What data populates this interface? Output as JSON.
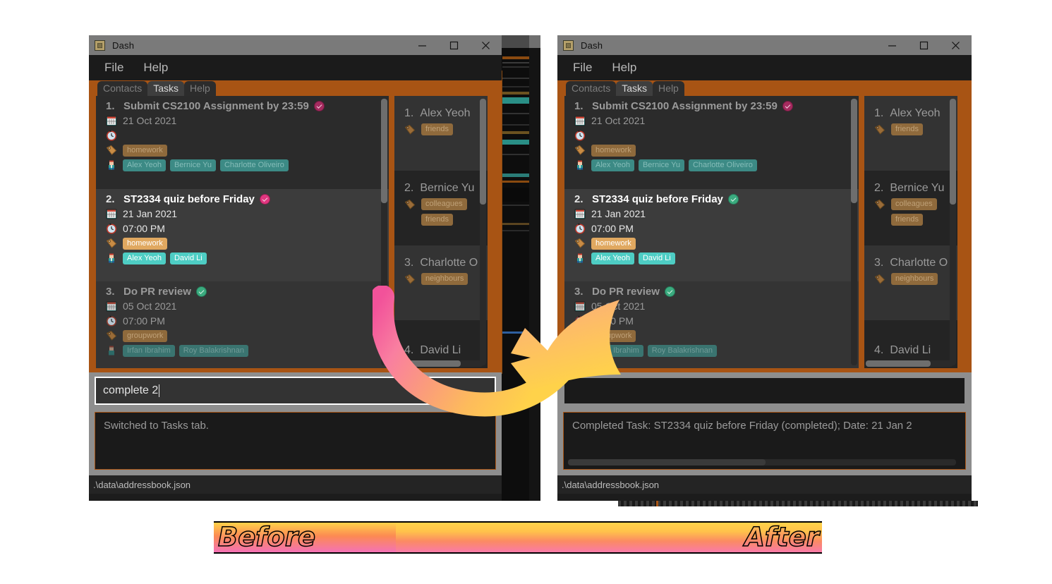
{
  "window": {
    "title": "Dash",
    "icon": "app-icon",
    "controls": {
      "minimize": "minimize-icon",
      "maximize": "maximize-icon",
      "close": "close-icon"
    },
    "menu": [
      "File",
      "Help"
    ],
    "tabs": [
      {
        "label": "Contacts",
        "active": false
      },
      {
        "label": "Tasks",
        "active": true
      },
      {
        "label": "Help",
        "active": false
      }
    ],
    "status_path": ".\\data\\addressbook.json"
  },
  "before": {
    "command_input": {
      "value": "complete 2",
      "placeholder": ""
    },
    "result": "Switched to Tasks tab.",
    "tasks": [
      {
        "index": "1.",
        "name": "Submit CS2100 Assignment by 23:59",
        "status": "incomplete",
        "date": "21 Oct 2021",
        "time": "",
        "tags": [
          "homework"
        ],
        "people": [
          "Alex Yeoh",
          "Bernice Yu",
          "Charlotte Oliveiro"
        ],
        "selected": false
      },
      {
        "index": "2.",
        "name": "ST2334 quiz before Friday",
        "status": "incomplete",
        "date": "21 Jan 2021",
        "time": "07:00 PM",
        "tags": [
          "homework"
        ],
        "people": [
          "Alex Yeoh",
          "David Li"
        ],
        "selected": true
      },
      {
        "index": "3.",
        "name": "Do PR review",
        "status": "complete",
        "date": "05 Oct 2021",
        "time": "07:00 PM",
        "tags": [
          "groupwork"
        ],
        "people": [
          "Irfan Ibrahim",
          "Roy Balakrishnan"
        ],
        "selected": false
      }
    ],
    "contacts": [
      {
        "index": "1.",
        "name": "Alex Yeoh",
        "tags": [
          "friends"
        ]
      },
      {
        "index": "2.",
        "name": "Bernice Yu",
        "tags": [
          "colleagues",
          "friends"
        ]
      },
      {
        "index": "3.",
        "name": "Charlotte O",
        "tags": [
          "neighbours"
        ]
      },
      {
        "index": "4.",
        "name": "David Li",
        "tags": []
      }
    ]
  },
  "after": {
    "command_input": {
      "value": "",
      "placeholder": ""
    },
    "result": "Completed Task: ST2334 quiz before Friday (completed); Date: 21 Jan 2",
    "tasks": [
      {
        "index": "1.",
        "name": "Submit CS2100 Assignment by 23:59",
        "status": "incomplete",
        "date": "21 Oct 2021",
        "time": "",
        "tags": [
          "homework"
        ],
        "people": [
          "Alex Yeoh",
          "Bernice Yu",
          "Charlotte Oliveiro"
        ],
        "selected": false
      },
      {
        "index": "2.",
        "name": "ST2334 quiz before Friday",
        "status": "complete",
        "date": "21 Jan 2021",
        "time": "07:00 PM",
        "tags": [
          "homework"
        ],
        "people": [
          "Alex Yeoh",
          "David Li"
        ],
        "selected": true
      },
      {
        "index": "3.",
        "name": "Do PR review",
        "status": "complete",
        "date": "05 Oct 2021",
        "time": "07:00 PM",
        "tags": [
          "groupwork"
        ],
        "people": [
          "Irfan Ibrahim",
          "Roy Balakrishnan"
        ],
        "selected": false
      }
    ],
    "contacts": [
      {
        "index": "1.",
        "name": "Alex Yeoh",
        "tags": [
          "friends"
        ]
      },
      {
        "index": "2.",
        "name": "Bernice Yu",
        "tags": [
          "colleagues",
          "friends"
        ]
      },
      {
        "index": "3.",
        "name": "Charlotte O",
        "tags": [
          "neighbours"
        ]
      },
      {
        "index": "4.",
        "name": "David Li",
        "tags": []
      }
    ]
  },
  "banner": {
    "left_label": "Before",
    "right_label": "After"
  },
  "colors": {
    "accent_orange": "#a85414",
    "tag_badge": "#e0a860",
    "person_badge": "#4ecdc4",
    "status_incomplete": "#e0367f",
    "status_complete": "#3bab7f",
    "titlebar": "#7a7a7a",
    "panel_bg": "#1f1f1f"
  }
}
